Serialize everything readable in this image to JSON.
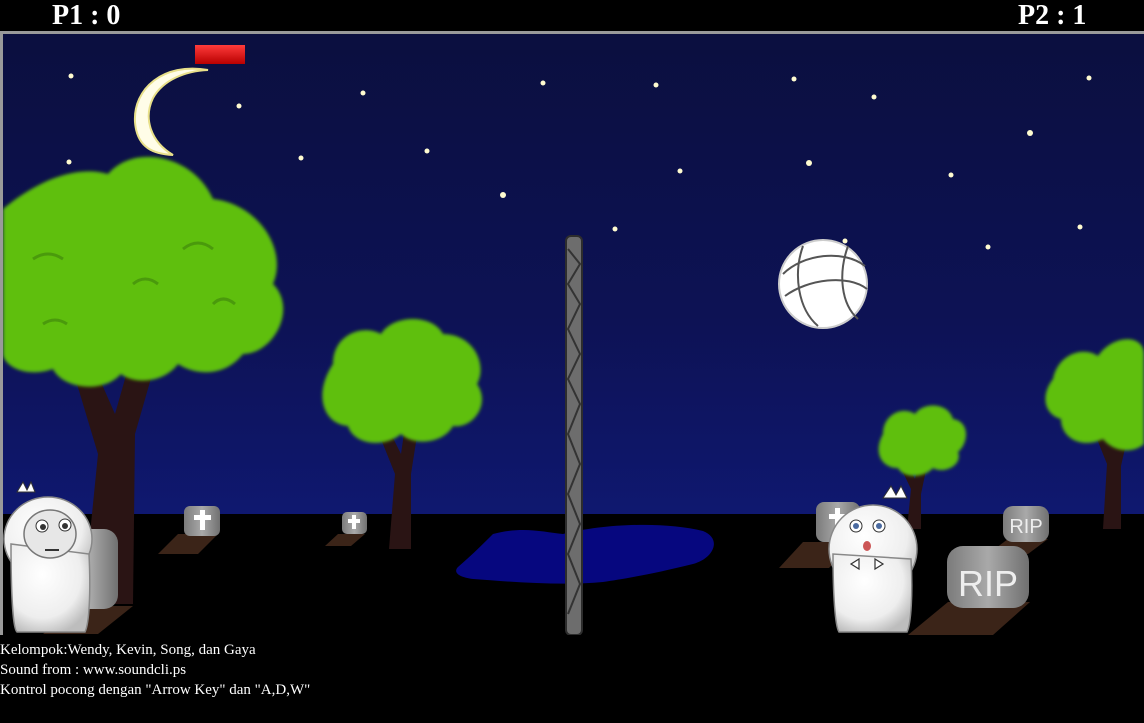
{
  "scoreboard": {
    "p1": "P1 : 0",
    "p2": "P2 : 1"
  },
  "scene": {
    "sky_color": "#0c1050",
    "ground_color": "#000000",
    "pond_color": "#06077f",
    "tree_color": "#5fbf10",
    "power_bar_color": "#e01010",
    "tombstone_text": "RIP"
  },
  "credits": {
    "line1": "Kelompok:Wendy, Kevin, Song, dan Gaya",
    "line2": "Sound from : www.soundcli.ps",
    "line3": "Kontrol pocong dengan \"Arrow Key\" dan \"A,D,W\""
  }
}
